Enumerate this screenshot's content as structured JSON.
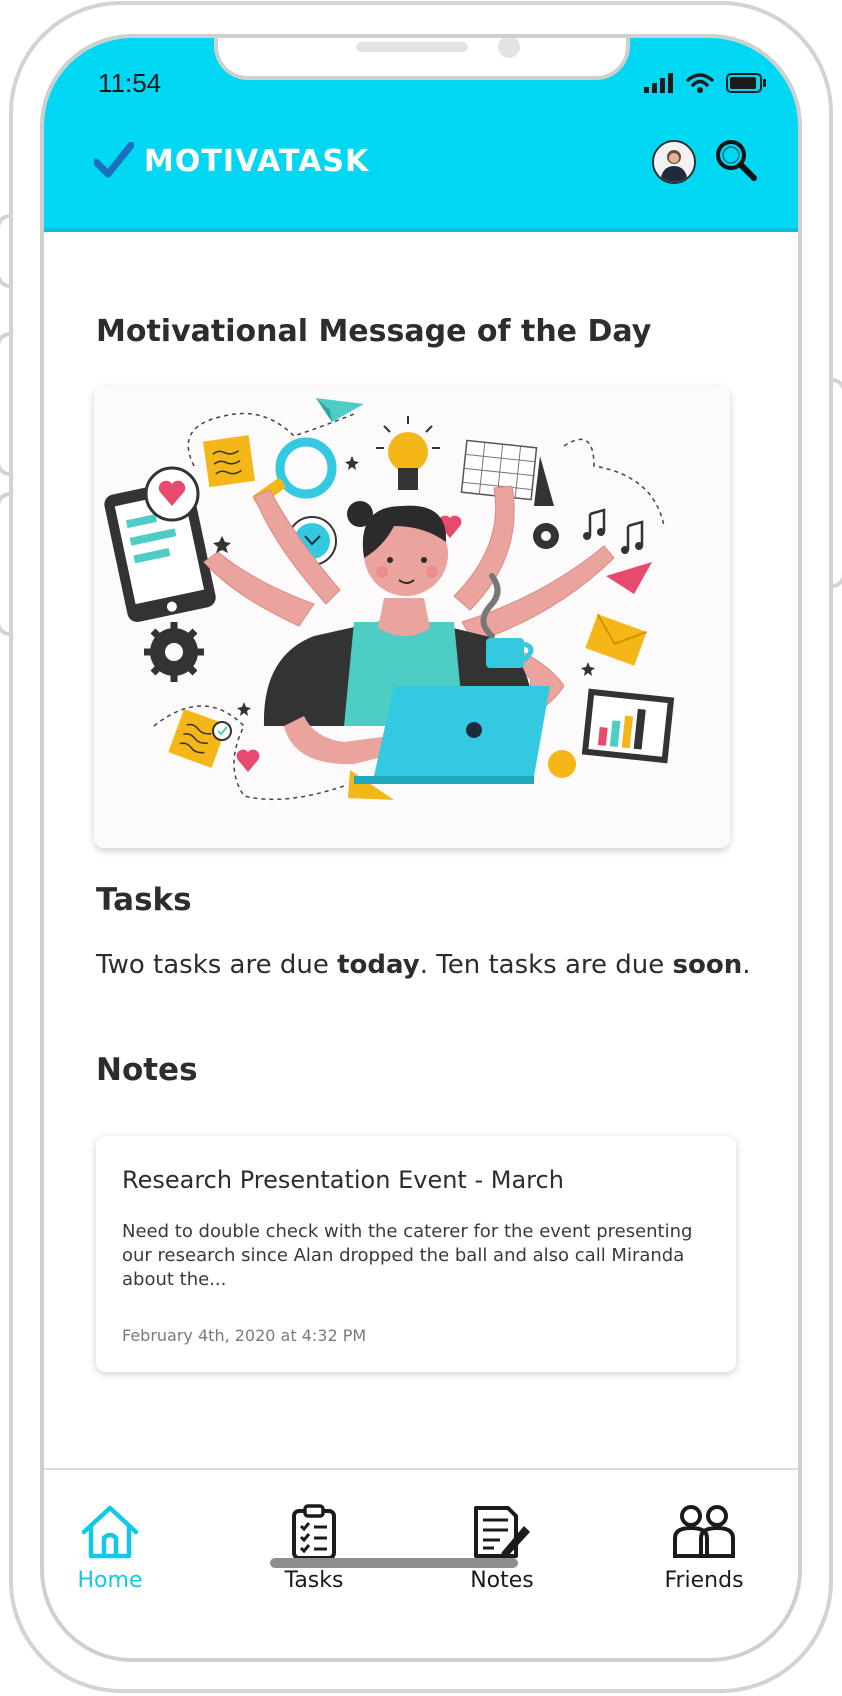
{
  "status_bar": {
    "time": "11:54"
  },
  "header": {
    "app_name": "MOTIVATASK",
    "logo_icon": "checkmark-icon",
    "search_icon": "search-icon",
    "avatar": "user-avatar"
  },
  "motivation": {
    "title": "Motivational Message of the Day"
  },
  "tasks": {
    "title": "Tasks",
    "text_1": "Two tasks are due ",
    "bold_1": "today",
    "text_2": ". Ten tasks are due ",
    "bold_2": "soon",
    "text_3": "."
  },
  "notes": {
    "title": "Notes",
    "items": [
      {
        "title": "Research Presentation Event - March",
        "body": "Need to double check with the caterer for the event presenting our research since Alan dropped the ball and also call Miranda about the...",
        "date": "February 4th, 2020 at 4:32 PM"
      }
    ]
  },
  "bottom_nav": {
    "items": [
      {
        "label": "Home",
        "icon": "home-icon",
        "active": true
      },
      {
        "label": "Tasks",
        "icon": "clipboard-checklist-icon",
        "active": false
      },
      {
        "label": "Notes",
        "icon": "notes-edit-icon",
        "active": false
      },
      {
        "label": "Friends",
        "icon": "friends-icon",
        "active": false
      }
    ]
  },
  "colors": {
    "header_bg": "#00d8f3",
    "accent": "#12c8e8",
    "text": "#2d2d2d"
  }
}
